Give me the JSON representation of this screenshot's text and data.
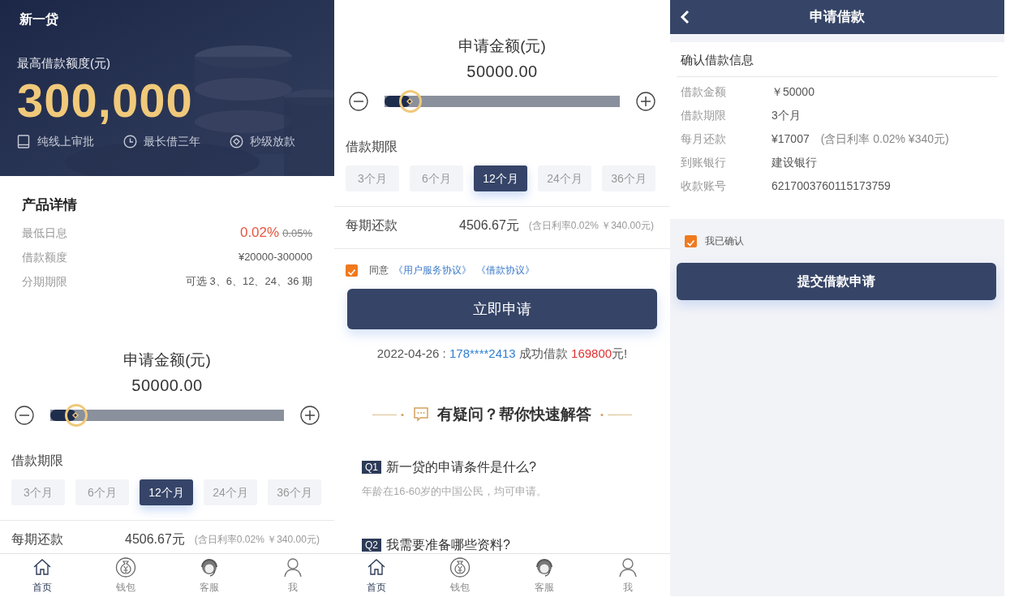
{
  "home_screen": {
    "app_title": "新一贷",
    "hero": {
      "label": "最高借款额度(元)",
      "amount": "300,000",
      "features": [
        {
          "label": "纯线上审批"
        },
        {
          "label": "最长借三年"
        },
        {
          "label": "秒级放款"
        }
      ]
    },
    "product": {
      "title": "产品详情",
      "rows": [
        {
          "label": "最低日息",
          "value": "0.02%",
          "original_value": "0.05%"
        },
        {
          "label": "借款额度",
          "value": "¥20000-300000"
        },
        {
          "label": "分期期限",
          "value": "可选 3、6、12、24、36 期"
        }
      ]
    },
    "calculator": {
      "label": "申请金额(元)",
      "amount": "50000.00",
      "slider": {
        "level": 0.11
      },
      "term": {
        "label": "借款期限",
        "options": [
          {
            "label": "3个月",
            "selected": false
          },
          {
            "label": "6个月",
            "selected": false
          },
          {
            "label": "12个月",
            "selected": true
          },
          {
            "label": "24个月",
            "selected": false
          },
          {
            "label": "36个月",
            "selected": false
          }
        ]
      },
      "repayment": {
        "label": "每期还款",
        "amount": "4506.67元",
        "note": "(含日利率0.02% ￥340.00元)"
      }
    },
    "tab_bar": [
      {
        "label": "首页",
        "selected": true
      },
      {
        "label": "钱包",
        "selected": false
      },
      {
        "label": "客服",
        "selected": false
      },
      {
        "label": "我",
        "selected": false
      }
    ]
  },
  "scrolled_home_screen": {
    "calculator": {
      "label": "申请金额(元)",
      "amount": "50000.00",
      "slider": {
        "level": 0.11
      },
      "term": {
        "label": "借款期限",
        "options": [
          {
            "label": "3个月",
            "selected": false
          },
          {
            "label": "6个月",
            "selected": false
          },
          {
            "label": "12个月",
            "selected": true
          },
          {
            "label": "24个月",
            "selected": false
          },
          {
            "label": "36个月",
            "selected": false
          }
        ]
      },
      "repayment": {
        "label": "每期还款",
        "amount": "4506.67元",
        "note": "(含日利率0.02% ￥340.00元)"
      }
    },
    "agreement": {
      "checked": true,
      "prefix": "同意",
      "links": [
        "《用户服务协议》",
        "《借款协议》"
      ]
    },
    "apply_button": "立即申请",
    "ticker": [
      {
        "kind": "plain",
        "text": "2022-04-26 : "
      },
      {
        "kind": "phone",
        "text": "178****2413"
      },
      {
        "kind": "plain",
        "text": " 成功借款 "
      },
      {
        "kind": "amount",
        "text": "169800"
      },
      {
        "kind": "plain",
        "text": "元!"
      }
    ],
    "faq": {
      "title": "有疑问？帮你快速解答",
      "items": [
        {
          "badge": "Q1",
          "question": "新一贷的申请条件是什么?",
          "answer": "年龄在16-60岁的中国公民，均可申请。"
        },
        {
          "badge": "Q2",
          "question": "我需要准备哪些资料?"
        }
      ]
    },
    "tab_bar": [
      {
        "label": "首页",
        "selected": true
      },
      {
        "label": "钱包",
        "selected": false
      },
      {
        "label": "客服",
        "selected": false
      },
      {
        "label": "我",
        "selected": false
      }
    ]
  },
  "apply_screen": {
    "header": {
      "title": "申请借款"
    },
    "confirm": {
      "title": "确认借款信息",
      "rows": [
        {
          "label": "借款金额",
          "value": "￥50000"
        },
        {
          "label": "借款期限",
          "value": "3个月"
        },
        {
          "label": "每月还款",
          "value": "¥17007",
          "note": "(含日利率 0.02% ¥340元)"
        },
        {
          "label": "到账银行",
          "value": "建设银行"
        },
        {
          "label": "收款账号",
          "value": "6217003760115173759"
        }
      ]
    },
    "agreement": {
      "checked": true,
      "label": "我已确认"
    },
    "submit_button": "提交借款申请"
  }
}
